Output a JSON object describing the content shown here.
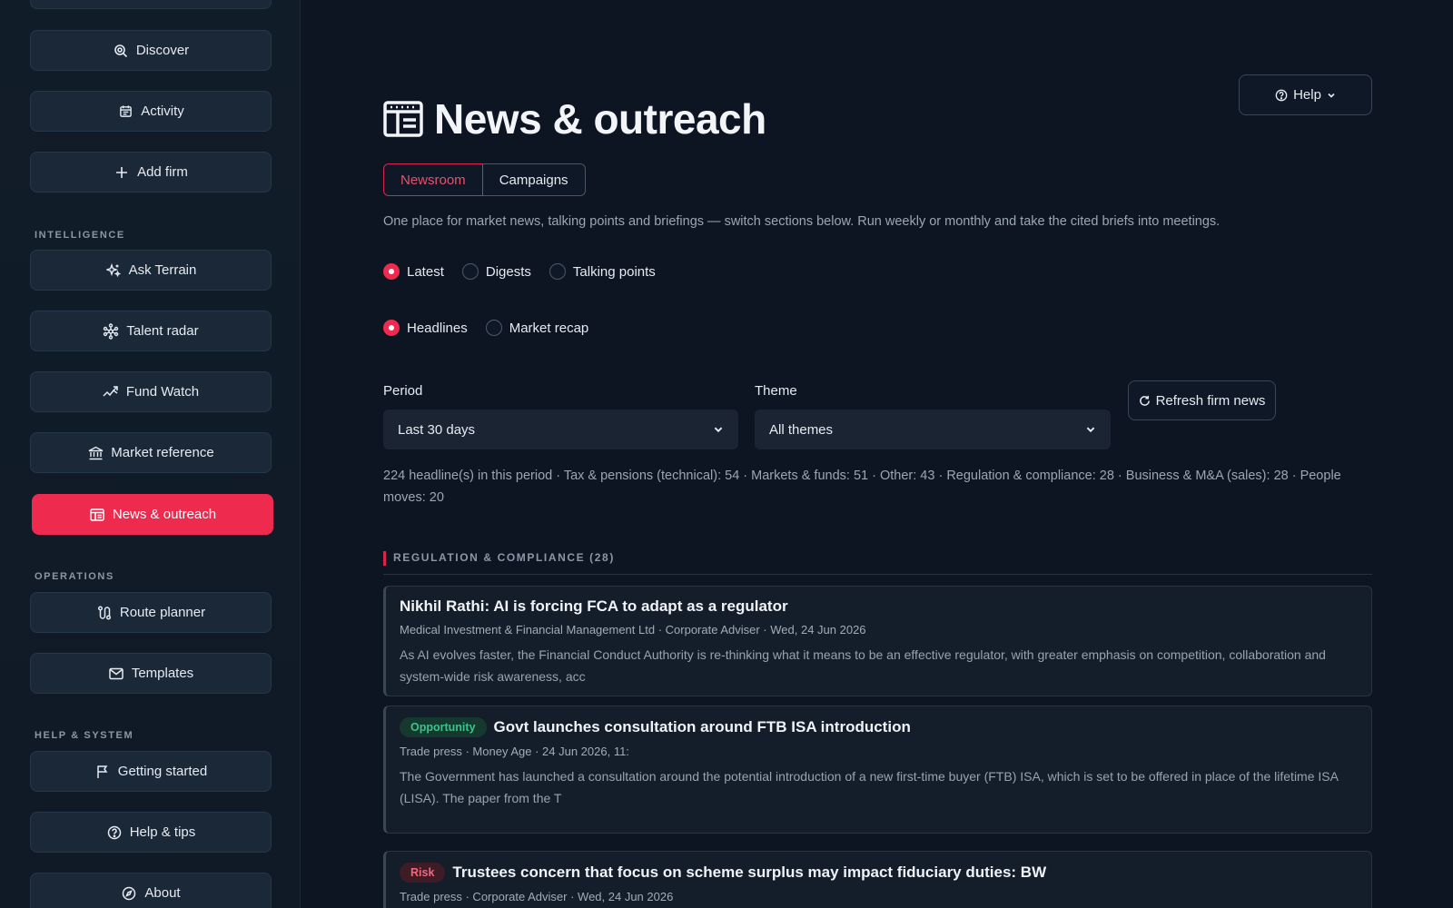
{
  "sidebar": {
    "items_top": [
      {
        "label": "Discover",
        "icon": "discover-icon"
      },
      {
        "label": "Activity",
        "icon": "calendar-icon"
      },
      {
        "label": "Add firm",
        "icon": "plus-icon"
      }
    ],
    "section_intelligence": "INTELLIGENCE",
    "items_intelligence": [
      {
        "label": "Ask Terrain",
        "icon": "sparkle-icon"
      },
      {
        "label": "Talent radar",
        "icon": "network-icon"
      },
      {
        "label": "Fund Watch",
        "icon": "trend-icon"
      },
      {
        "label": "Market reference",
        "icon": "bank-icon"
      },
      {
        "label": "News & outreach",
        "icon": "newspaper-icon",
        "active": true
      }
    ],
    "section_operations": "OPERATIONS",
    "items_operations": [
      {
        "label": "Route planner",
        "icon": "route-icon"
      },
      {
        "label": "Templates",
        "icon": "mail-icon"
      }
    ],
    "section_help": "HELP & SYSTEM",
    "items_help": [
      {
        "label": "Getting started",
        "icon": "flag-icon"
      },
      {
        "label": "Help & tips",
        "icon": "question-icon"
      },
      {
        "label": "About",
        "icon": "compass-icon"
      }
    ]
  },
  "header": {
    "help_label": "Help",
    "title": "News & outreach"
  },
  "tabs": [
    "Newsroom",
    "Campaigns"
  ],
  "description": "One place for market news, talking points and briefings — switch sections below. Run weekly or monthly and take the cited briefs into meetings.",
  "mode_options": [
    {
      "label": "Latest",
      "selected": true
    },
    {
      "label": "Digests",
      "selected": false
    },
    {
      "label": "Talking points",
      "selected": false
    }
  ],
  "view_options": [
    {
      "label": "Headlines",
      "selected": true
    },
    {
      "label": "Market recap",
      "selected": false
    }
  ],
  "filters": {
    "period_label": "Period",
    "period_value": "Last 30 days",
    "theme_label": "Theme",
    "theme_value": "All themes",
    "refresh_label": "Refresh firm news"
  },
  "summary": "224 headline(s) in this period · Tax & pensions (technical): 54 · Markets & funds: 51 · Other: 43 · Regulation & compliance: 28 · Business & M&A (sales): 28 · People moves: 20",
  "group": {
    "heading": "REGULATION & COMPLIANCE (28)"
  },
  "articles": [
    {
      "badge": "",
      "title": "Nikhil Rathi: AI is forcing FCA to adapt as a regulator",
      "meta": "Medical Investment & Financial Management Ltd · Corporate Adviser · Wed, 24 Jun 2026",
      "body": "As AI evolves faster, the Financial Conduct Authority is re-thinking what it means to be an effective regulator, with greater emphasis on competition, collaboration and system-wide risk awareness, acc"
    },
    {
      "badge": "Opportunity",
      "title": "Govt launches consultation around FTB ISA introduction",
      "meta": "Trade press · Money Age · 24 Jun 2026, 11:",
      "body": "The Government has launched a consultation around the potential introduction of a new first-time buyer (FTB) ISA, which is set to be offered in place of the lifetime ISA (LISA). The paper from the T"
    },
    {
      "badge": "Risk",
      "title": "Trustees concern that focus on scheme surplus may impact fiduciary duties: BW",
      "meta": "Trade press · Corporate Adviser · Wed, 24 Jun 2026",
      "body": ""
    }
  ],
  "colors": {
    "accent": "#ee2a4f",
    "background": "#0d1522",
    "sidebar": "#111c29"
  }
}
